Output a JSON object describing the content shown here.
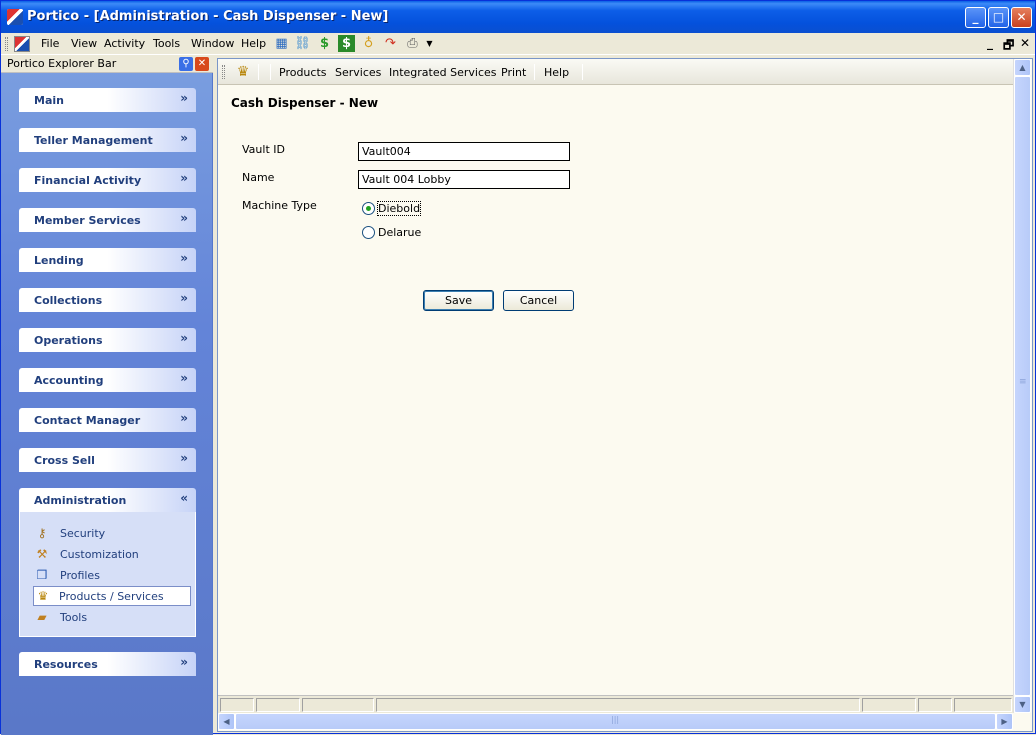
{
  "window": {
    "title": "Portico - [Administration - Cash Dispenser - New]",
    "min_label": "_",
    "max_label": "□",
    "close_label": "✕"
  },
  "menu": {
    "items": [
      "File",
      "View",
      "Activity",
      "Tools",
      "Window",
      "Help"
    ],
    "mdi_controls": [
      "_",
      "🗗",
      "✕"
    ]
  },
  "explorer": {
    "title": "Portico Explorer Bar",
    "groups": [
      {
        "label": "Main",
        "chevron": "»"
      },
      {
        "label": "Teller Management",
        "chevron": "»"
      },
      {
        "label": "Financial Activity",
        "chevron": "»"
      },
      {
        "label": "Member Services",
        "chevron": "»"
      },
      {
        "label": "Lending",
        "chevron": "»"
      },
      {
        "label": "Collections",
        "chevron": "»"
      },
      {
        "label": "Operations",
        "chevron": "»"
      },
      {
        "label": "Accounting",
        "chevron": "»"
      },
      {
        "label": "Contact Manager",
        "chevron": "»"
      },
      {
        "label": "Cross Sell",
        "chevron": "»"
      },
      {
        "label": "Administration",
        "chevron": "«"
      },
      {
        "label": "Resources",
        "chevron": "»"
      }
    ],
    "admin_items": [
      {
        "label": "Security",
        "icon": "key-icon"
      },
      {
        "label": "Customization",
        "icon": "wrench-icon"
      },
      {
        "label": "Profiles",
        "icon": "profiles-icon"
      },
      {
        "label": "Products / Services",
        "icon": "products-icon",
        "selected": true
      },
      {
        "label": "Tools",
        "icon": "toolbox-icon"
      }
    ]
  },
  "content_toolbar": {
    "items": [
      "Products",
      "Services",
      "Integrated Services",
      "Print",
      "Help"
    ]
  },
  "form": {
    "heading": "Cash Dispenser - New",
    "vault_id_label": "Vault ID",
    "vault_id_value": "Vault004",
    "name_label": "Name",
    "name_value": "Vault 004 Lobby",
    "machine_type_label": "Machine Type",
    "machine_types": [
      "Diebold",
      "Delarue"
    ],
    "selected_machine_type": "Diebold",
    "save_label": "Save",
    "cancel_label": "Cancel"
  }
}
